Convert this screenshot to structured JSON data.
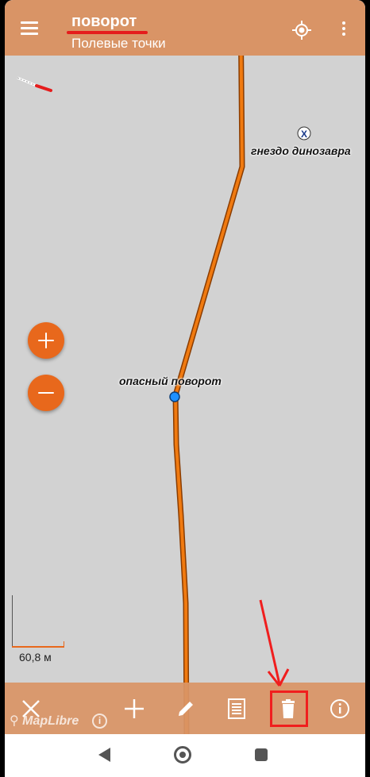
{
  "app_bar": {
    "title": "поворот",
    "subtitle": "Полевые точки"
  },
  "map": {
    "labels": {
      "nest": "гнездо динозавра",
      "turn": "опасный поворот"
    },
    "scale_label": "60,8 м",
    "route_color": "#f07a10",
    "selected_point_color": "#1e90ff"
  },
  "toolbar": {
    "items": [
      "close-icon",
      "plus-icon",
      "pencil-icon",
      "list-icon",
      "trash-icon",
      "info-icon"
    ],
    "highlighted": "trash-icon"
  },
  "attribution": {
    "logo": "MapLibre",
    "info": "i"
  },
  "colors": {
    "app_bar": "#d99466",
    "accent": "#e8681c",
    "highlight": "#f01e1e"
  }
}
